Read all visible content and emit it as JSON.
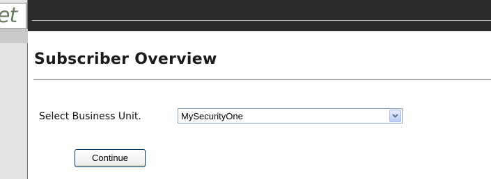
{
  "logo": {
    "text": "et"
  },
  "page": {
    "title": "Subscriber Overview"
  },
  "form": {
    "business_unit_label": "Select Business Unit.",
    "business_unit_selected": "MySecurityOne",
    "continue_label": "Continue"
  },
  "icons": {
    "dropdown": "chevron-down-icon"
  },
  "colors": {
    "header_band": "#2b2b2b",
    "sidebar": "#e4e4e4",
    "select_border": "#7f9db9",
    "button_border": "#003c74"
  }
}
